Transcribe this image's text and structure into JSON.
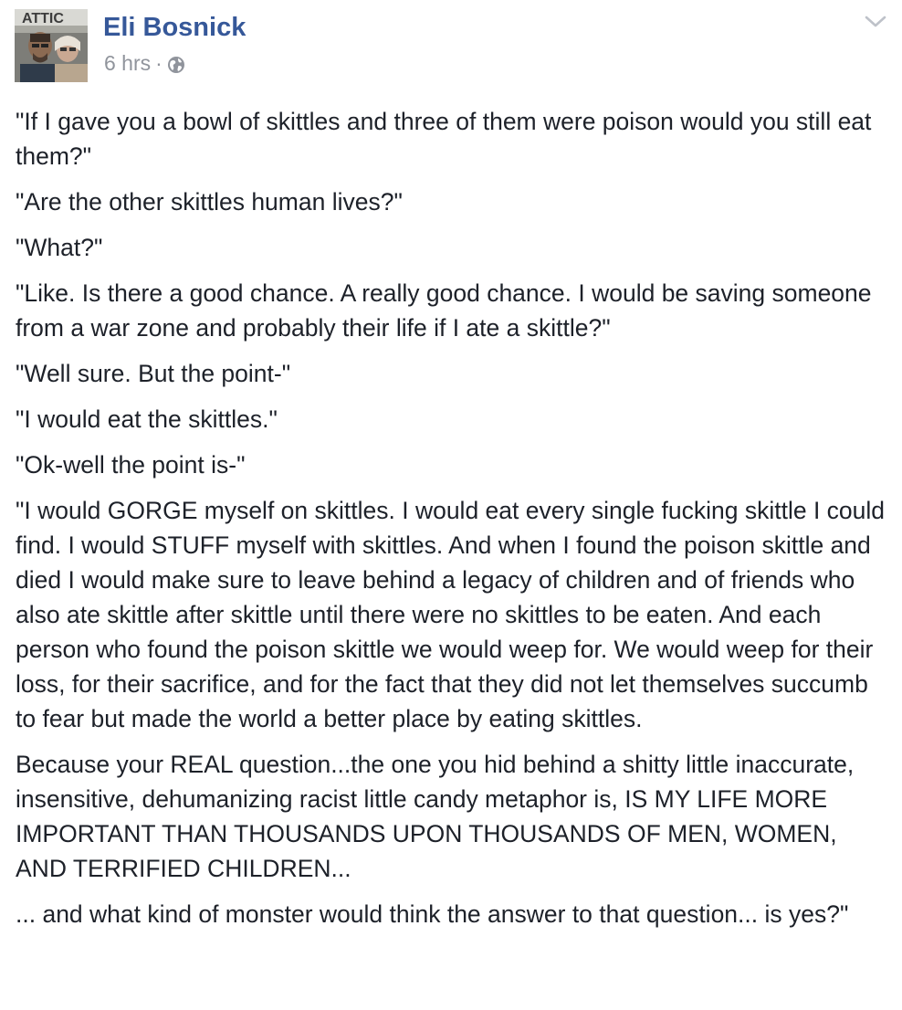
{
  "post": {
    "author": "Eli Bosnick",
    "timestamp": "6 hrs",
    "separator": "·",
    "audience_icon": "globe-icon",
    "menu_icon": "chevron-down-icon",
    "avatar_text": "ATTIC",
    "paragraphs": [
      "\"If I gave you a bowl of skittles and three of them were poison would you still eat them?\"",
      "\"Are the other skittles human lives?\"",
      "\"What?\"",
      "\"Like. Is there a good chance. A really good chance. I would be saving someone from a war zone and probably their life if I ate a skittle?\"",
      "\"Well sure. But the point-\"",
      "\"I would eat the skittles.\"",
      "\"Ok-well the point is-\"",
      "\"I would GORGE myself on skittles. I would eat every single fucking skittle I could find. I would STUFF myself with skittles. And when I found the poison skittle and died I would make sure to leave behind a legacy of children and of friends who also ate skittle after skittle until there were no skittles to be eaten. And each person who found the poison skittle we would weep for. We would weep for their loss, for their sacrifice, and for the fact that they did not let themselves succumb to fear but made the world a better place by eating skittles.",
      "Because your REAL question...the one you hid behind a shitty little inaccurate, insensitive, dehumanizing racist little candy metaphor is, IS MY LIFE MORE IMPORTANT THAN THOUSANDS UPON THOUSANDS OF MEN, WOMEN, AND TERRIFIED CHILDREN...",
      "... and what kind of monster would think the answer to that question... is yes?\""
    ]
  },
  "colors": {
    "author_link": "#365899",
    "meta_text": "#90949c",
    "body_text": "#1d2129",
    "chevron": "#bec2c9"
  }
}
